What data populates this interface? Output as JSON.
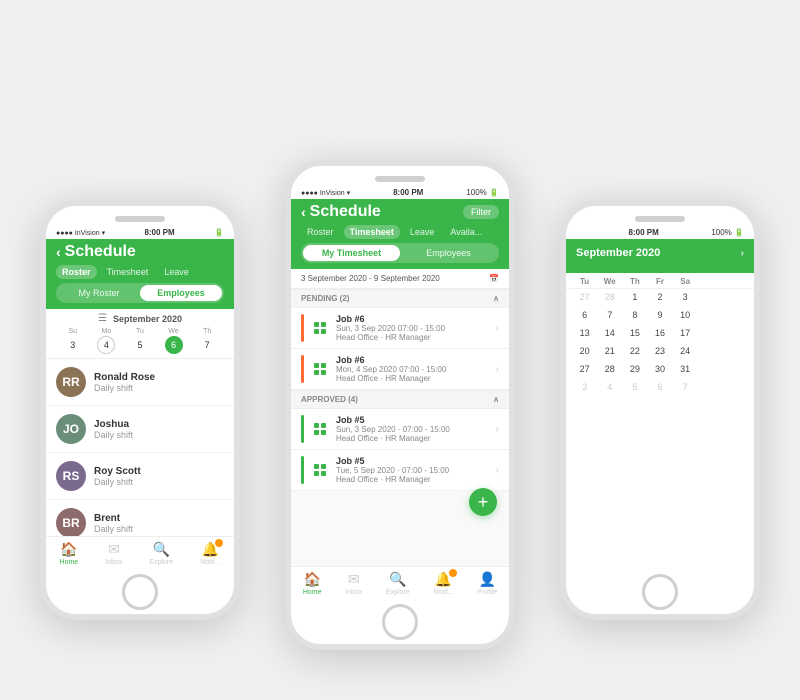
{
  "phones": {
    "left": {
      "status": {
        "left": "●●●● InVision ▾",
        "time": "8:00 PM",
        "right": "🔋"
      },
      "header": {
        "back": "‹",
        "title": "Schedule",
        "tabs": [
          "Roster",
          "Timesheet",
          "Leave"
        ],
        "toggle": [
          "My Roster",
          "Employees"
        ]
      },
      "calendar": {
        "month": "September  2020",
        "days": [
          {
            "name": "Su",
            "num": "3",
            "style": "normal"
          },
          {
            "name": "Mo",
            "num": "4",
            "style": "circled"
          },
          {
            "name": "Tu",
            "num": "5",
            "style": "normal"
          },
          {
            "name": "We",
            "num": "6",
            "style": "today"
          },
          {
            "name": "Th",
            "num": "7",
            "style": "normal"
          }
        ]
      },
      "employees": [
        {
          "name": "Ronald Rose",
          "shift": "Daily shift",
          "initials": "RR",
          "avClass": "av1"
        },
        {
          "name": "Joshua",
          "shift": "Daily shift",
          "initials": "JO",
          "avClass": "av2"
        },
        {
          "name": "Roy Scott",
          "shift": "Daily shift",
          "initials": "RS",
          "avClass": "av3"
        },
        {
          "name": "Brent",
          "shift": "Daily shift",
          "initials": "BR",
          "avClass": "av4"
        }
      ],
      "bottomNav": [
        {
          "icon": "🏠",
          "label": "Home",
          "active": true
        },
        {
          "icon": "✉",
          "label": "Inbox",
          "active": false
        },
        {
          "icon": "🔍",
          "label": "Explore",
          "active": false
        },
        {
          "icon": "🔔",
          "label": "Notifications",
          "active": false,
          "badge": true
        }
      ]
    },
    "center": {
      "status": {
        "left": "●●●● InVision ▾",
        "time": "8:00 PM",
        "right": "100% 🔋"
      },
      "header": {
        "back": "‹",
        "title": "Schedule",
        "filter": "Filter",
        "tabs": [
          "Roster",
          "Timesheet",
          "Leave",
          "Availa..."
        ],
        "activeTab": "Timesheet",
        "toggle": [
          "My Timesheet",
          "Employees"
        ],
        "activeToggle": "My Timesheet"
      },
      "dateRange": "3 September 2020 - 9 September 2020",
      "sections": [
        {
          "label": "PENDING (2)",
          "jobs": [
            {
              "title": "Job #6",
              "meta1": "Sun, 3 Sep 2020  07:00 - 15:00",
              "meta2": "Head Office  ·  HR Manager",
              "accent": "orange"
            },
            {
              "title": "Job #6",
              "meta1": "Mon, 4 Sep 2020  07:00 - 15:00",
              "meta2": "Head Office  ·  HR Manager",
              "accent": "orange"
            }
          ]
        },
        {
          "label": "APPROVED (4)",
          "jobs": [
            {
              "title": "Job #5",
              "meta1": "Sun, 3 Sep 2020 · 07:00 - 15:00",
              "meta2": "Head Office  ·  HR Manager",
              "accent": "green"
            },
            {
              "title": "Job #5",
              "meta1": "Tue, 5 Sep 2020 · 07:00 - 15:00",
              "meta2": "Head Office  ·  HR Manager",
              "accent": "green"
            }
          ]
        }
      ],
      "fab": "+",
      "bottomNav": [
        {
          "icon": "🏠",
          "label": "Home",
          "active": true
        },
        {
          "icon": "✉",
          "label": "Inbox",
          "active": false
        },
        {
          "icon": "🔍",
          "label": "Explore",
          "active": false
        },
        {
          "icon": "🔔",
          "label": "Notifications",
          "active": false,
          "badge": true
        },
        {
          "icon": "👤",
          "label": "Profile",
          "active": false
        }
      ]
    },
    "right": {
      "status": {
        "time": "8:00 PM",
        "right": "100% 🔋"
      },
      "header": {
        "monthYear": "September 2020"
      },
      "calendar": {
        "dayHeaders": [
          "Tu",
          "We",
          "Th",
          "Fr",
          "Sa"
        ],
        "weeks": [
          [
            "27",
            "28",
            "1",
            "2",
            "3"
          ],
          [
            "6",
            "7",
            "8",
            "9",
            "10"
          ],
          [
            "13",
            "14",
            "15",
            "16",
            "17"
          ],
          [
            "20",
            "21",
            "22",
            "23",
            "24"
          ],
          [
            "27",
            "28",
            "29",
            "30",
            "31"
          ],
          [
            "3",
            "4",
            "5",
            "6",
            "7"
          ]
        ],
        "otherMonthCells": [
          "27",
          "28",
          "3",
          "4",
          "5",
          "6",
          "7"
        ],
        "todayCell": "10",
        "selectedCell": "20"
      }
    }
  }
}
